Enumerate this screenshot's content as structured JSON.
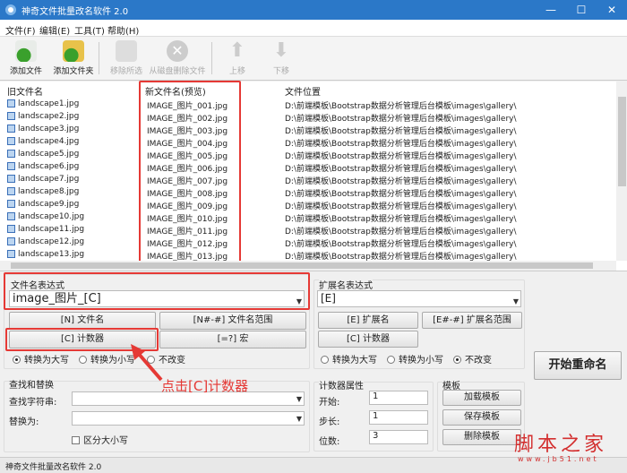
{
  "window": {
    "title": "神奇文件批量改名软件 2.0",
    "minimize": "—",
    "maximize": "☐",
    "close": "✕"
  },
  "menu": [
    "文件(F)",
    "编辑(E)",
    "工具(T)",
    "帮助(H)"
  ],
  "toolbar": {
    "add_file": "添加文件",
    "add_folder": "添加文件夹",
    "remove_selected": "移除所选",
    "delete_from_disk": "从磁盘删除文件",
    "move_up": "上移",
    "move_down": "下移"
  },
  "list": {
    "headers": {
      "old": "旧文件名",
      "new": "新文件名(预览)",
      "path": "文件位置"
    },
    "rows": [
      {
        "old": "landscape1.jpg",
        "new": "IMAGE_图片_001.jpg",
        "path": "D:\\前端模板\\Bootstrap数据分析管理后台模板\\images\\gallery\\"
      },
      {
        "old": "landscape2.jpg",
        "new": "IMAGE_图片_002.jpg",
        "path": "D:\\前端模板\\Bootstrap数据分析管理后台模板\\images\\gallery\\"
      },
      {
        "old": "landscape3.jpg",
        "new": "IMAGE_图片_003.jpg",
        "path": "D:\\前端模板\\Bootstrap数据分析管理后台模板\\images\\gallery\\"
      },
      {
        "old": "landscape4.jpg",
        "new": "IMAGE_图片_004.jpg",
        "path": "D:\\前端模板\\Bootstrap数据分析管理后台模板\\images\\gallery\\"
      },
      {
        "old": "landscape5.jpg",
        "new": "IMAGE_图片_005.jpg",
        "path": "D:\\前端模板\\Bootstrap数据分析管理后台模板\\images\\gallery\\"
      },
      {
        "old": "landscape6.jpg",
        "new": "IMAGE_图片_006.jpg",
        "path": "D:\\前端模板\\Bootstrap数据分析管理后台模板\\images\\gallery\\"
      },
      {
        "old": "landscape7.jpg",
        "new": "IMAGE_图片_007.jpg",
        "path": "D:\\前端模板\\Bootstrap数据分析管理后台模板\\images\\gallery\\"
      },
      {
        "old": "landscape8.jpg",
        "new": "IMAGE_图片_008.jpg",
        "path": "D:\\前端模板\\Bootstrap数据分析管理后台模板\\images\\gallery\\"
      },
      {
        "old": "landscape9.jpg",
        "new": "IMAGE_图片_009.jpg",
        "path": "D:\\前端模板\\Bootstrap数据分析管理后台模板\\images\\gallery\\"
      },
      {
        "old": "landscape10.jpg",
        "new": "IMAGE_图片_010.jpg",
        "path": "D:\\前端模板\\Bootstrap数据分析管理后台模板\\images\\gallery\\"
      },
      {
        "old": "landscape11.jpg",
        "new": "IMAGE_图片_011.jpg",
        "path": "D:\\前端模板\\Bootstrap数据分析管理后台模板\\images\\gallery\\"
      },
      {
        "old": "landscape12.jpg",
        "new": "IMAGE_图片_012.jpg",
        "path": "D:\\前端模板\\Bootstrap数据分析管理后台模板\\images\\gallery\\"
      },
      {
        "old": "landscape13.jpg",
        "new": "IMAGE_图片_013.jpg",
        "path": "D:\\前端模板\\Bootstrap数据分析管理后台模板\\images\\gallery\\"
      }
    ]
  },
  "name_expr": {
    "label": "文件名表达式",
    "value": "image_图片_[C]",
    "btn_name": "[N] 文件名",
    "btn_name_range": "[N#-#] 文件名范围",
    "btn_counter": "[C] 计数器",
    "btn_macro": "[=?] 宏",
    "upper": "转换为大写",
    "lower": "转换为小写",
    "keep": "不改变",
    "selected": "upper"
  },
  "ext_expr": {
    "label": "扩展名表达式",
    "value": "[E]",
    "btn_ext": "[E] 扩展名",
    "btn_ext_range": "[E#-#] 扩展名范围",
    "btn_counter": "[C] 计数器",
    "upper": "转换为大写",
    "lower": "转换为小写",
    "keep": "不改变",
    "selected": "keep"
  },
  "find_replace": {
    "label": "查找和替换",
    "find_label": "查找字符串:",
    "find_value": "",
    "replace_label": "替换为:",
    "replace_value": "",
    "case_label": "区分大小写",
    "case_checked": false
  },
  "counter": {
    "label": "计数器属性",
    "start_label": "开始:",
    "start": "1",
    "step_label": "步长:",
    "step": "1",
    "digits_label": "位数:",
    "digits": "3"
  },
  "template": {
    "label": "模板",
    "load": "加载模板",
    "save": "保存模板",
    "delete": "删除模板"
  },
  "start_rename": "开始重命名",
  "annotation": "点击[C]计数器",
  "watermark": {
    "name": "脚本之家",
    "url": "www.jb51.net"
  },
  "status": "神奇文件批量改名软件 2.0",
  "colors": {
    "titlebar": "#2b78c8",
    "highlight": "#e53935"
  }
}
